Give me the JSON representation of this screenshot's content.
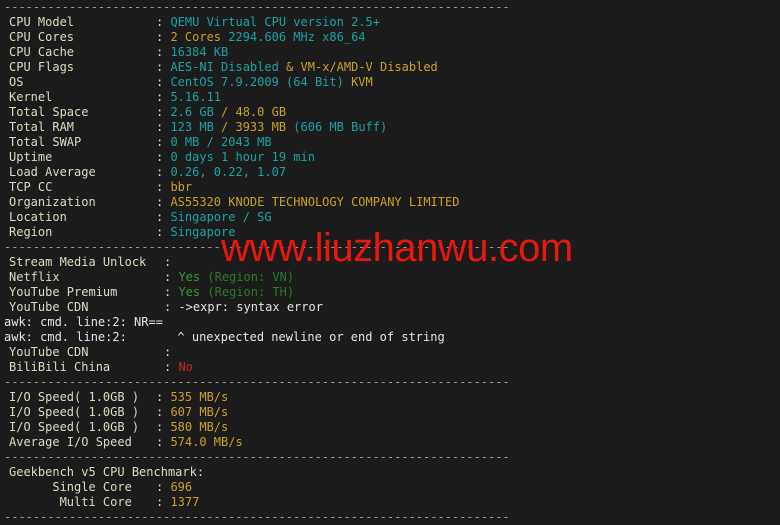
{
  "terminal": {
    "background_color": "#1b1b1b",
    "label_color": "#dcdcc0",
    "cyan_color": "#18a4a4",
    "gold_color": "#c9a227",
    "green_color": "#2f9e2f",
    "red_color": "#c42b1c",
    "separator_char": "-",
    "separator": "----------------------------------------------------------------------"
  },
  "watermark": {
    "text": "www.liuzhanwu.com",
    "color": "#e8190c"
  },
  "system_info": {
    "rows": [
      {
        "label": "CPU Model",
        "value": "QEMU Virtual CPU version 2.5+"
      },
      {
        "label": "CPU Cores",
        "value": "2 Cores 2294.606 MHz x86_64"
      },
      {
        "label": "CPU Cache",
        "value": "16384 KB"
      },
      {
        "label": "CPU Flags",
        "value": "AES-NI Disabled & VM-x/AMD-V Disabled"
      },
      {
        "label": "OS",
        "value": "CentOS 7.9.2009 (64 Bit) KVM"
      },
      {
        "label": "Kernel",
        "value": "5.16.11"
      },
      {
        "label": "Total Space",
        "value": "2.6 GB / 48.0 GB"
      },
      {
        "label": "Total RAM",
        "value": "123 MB / 3933 MB (606 MB Buff)"
      },
      {
        "label": "Total SWAP",
        "value": "0 MB / 2043 MB"
      },
      {
        "label": "Uptime",
        "value": "0 days 1 hour 19 min"
      },
      {
        "label": "Load Average",
        "value": "0.26, 0.22, 1.07"
      },
      {
        "label": "TCP CC",
        "value": "bbr"
      },
      {
        "label": "Organization",
        "value": "AS55320 KNODE TECHNOLOGY COMPANY LIMITED"
      },
      {
        "label": "Location",
        "value": "Singapore / SG"
      },
      {
        "label": "Region",
        "value": "Singapore"
      }
    ],
    "cpu_model": "QEMU Virtual CPU version 2.5+",
    "cpu_cores_count": "2 Cores",
    "cpu_cores_rest": " 2294.606 MHz x86_64",
    "cpu_cache": "16384 KB",
    "cpu_flags_aes": "AES-NI Disabled",
    "cpu_flags_sep": " & ",
    "cpu_flags_vm": "VM-x/AMD-V Disabled",
    "os_name": "CentOS 7.9.2009 (64 Bit)",
    "os_virt": " KVM",
    "kernel": "5.16.11",
    "space_used": "2.6 GB",
    "space_total": " / 48.0 GB",
    "ram_used": "123 MB",
    "ram_total": " / 3933 MB ",
    "ram_buff": "(606 MB Buff)",
    "swap_used": "0 MB",
    "swap_total": " / 2043 MB",
    "uptime": "0 days 1 hour 19 min",
    "load_average": "0.26, 0.22, 1.07",
    "tcp_cc": "bbr",
    "organization": "AS55320 KNODE TECHNOLOGY COMPANY LIMITED",
    "location": "Singapore / SG",
    "region": "Singapore",
    "labels": {
      "cpu_model": "CPU Model",
      "cpu_cores": "CPU Cores",
      "cpu_cache": "CPU Cache",
      "cpu_flags": "CPU Flags",
      "os": "OS",
      "kernel": "Kernel",
      "total_space": "Total Space",
      "total_ram": "Total RAM",
      "total_swap": "Total SWAP",
      "uptime": "Uptime",
      "load_average": "Load Average",
      "tcp_cc": "TCP CC",
      "organization": "Organization",
      "location": "Location",
      "region": "Region"
    }
  },
  "stream_media": {
    "heading": "Stream Media Unlock",
    "heading_value": "",
    "labels": {
      "netflix": "Netflix",
      "youtube_premium": "YouTube Premium",
      "youtube_cdn": "YouTube CDN",
      "bilibili_china": "BiliBili China"
    },
    "netflix_status": "Yes",
    "netflix_region": " (Region: VN)",
    "youtube_premium_status": "Yes",
    "youtube_premium_region": " (Region: TH)",
    "youtube_cdn_error": "->expr: syntax error",
    "youtube_cdn_second": "",
    "bilibili_status": "No",
    "awk_error_1": "awk: cmd. line:2: NR==",
    "awk_error_2": "awk: cmd. line:2:       ^ unexpected newline or end of string"
  },
  "io_speed": {
    "rows": [
      {
        "label": "I/O Speed( 1.0GB )",
        "value": "535 MB/s"
      },
      {
        "label": "I/O Speed( 1.0GB )",
        "value": "607 MB/s"
      },
      {
        "label": "I/O Speed( 1.0GB )",
        "value": "580 MB/s"
      },
      {
        "label": "Average I/O Speed",
        "value": "574.0 MB/s"
      }
    ],
    "run1_label": "I/O Speed( 1.0GB )",
    "run1_value": "535 MB/s",
    "run2_label": "I/O Speed( 1.0GB )",
    "run2_value": "607 MB/s",
    "run3_label": "I/O Speed( 1.0GB )",
    "run3_value": "580 MB/s",
    "avg_label": "Average I/O Speed",
    "avg_value": "574.0 MB/s"
  },
  "geekbench": {
    "heading": "Geekbench v5 CPU Benchmark:",
    "single_core_label": "      Single Core",
    "single_core_value": "696",
    "multi_core_label": "       Multi Core",
    "multi_core_value": "1377"
  }
}
